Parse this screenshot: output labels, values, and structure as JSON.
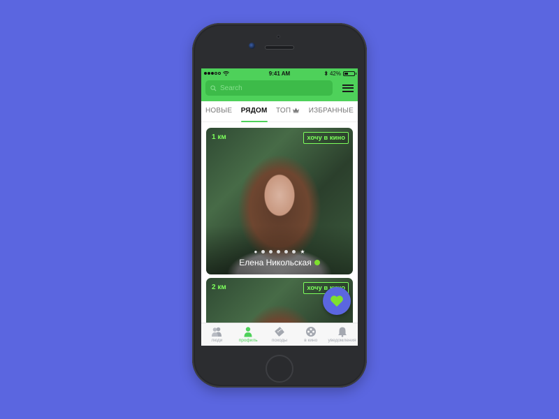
{
  "status_bar": {
    "signal_dots_filled": 3,
    "signal_dots_total": 5,
    "time": "9:41 AM",
    "bluetooth_icon": "bluetooth-icon",
    "battery_percent": "42%",
    "battery_level": 0.42
  },
  "header": {
    "search_placeholder": "Search",
    "search_value": "",
    "menu_icon": "hamburger-menu-icon"
  },
  "tabs": [
    {
      "label": "НОВЫЕ",
      "active": false
    },
    {
      "label": "РЯДОМ",
      "active": true
    },
    {
      "label": "ТОП",
      "icon": "crown-icon",
      "active": false
    },
    {
      "label": "ИЗБРАННЫЕ",
      "active": false
    }
  ],
  "cards": [
    {
      "distance": "1 км",
      "tag": "хочу в кино",
      "name": "Елена Никольская",
      "online": true,
      "photo_pages": 7,
      "current_page": 1
    },
    {
      "distance": "2 км",
      "tag": "хочу в кино"
    }
  ],
  "fab": {
    "icon": "heart-icon"
  },
  "bottom_nav": [
    {
      "label": "люди",
      "icon": "people-icon",
      "active": false
    },
    {
      "label": "профиль",
      "icon": "person-icon",
      "active": true
    },
    {
      "label": "походы",
      "icon": "tickets-icon",
      "active": false
    },
    {
      "label": "в кино",
      "icon": "film-reel-icon",
      "active": false
    },
    {
      "label": "уведомления",
      "icon": "bell-icon",
      "active": false
    }
  ],
  "colors": {
    "background": "#5b66e0",
    "accent_green": "#4ed15a",
    "tag_green": "#7dff5c",
    "fab_blue": "#5b66e0",
    "heart_green": "#7ee02e"
  }
}
